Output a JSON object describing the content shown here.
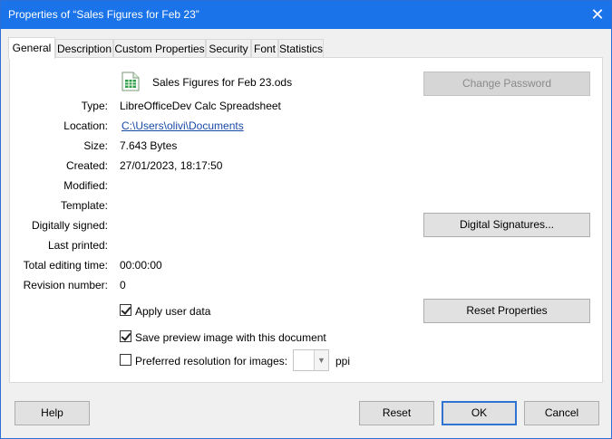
{
  "window": {
    "title": "Properties of “Sales Figures for Feb 23”",
    "close_glyph": "✕"
  },
  "tabs": [
    {
      "label": "General"
    },
    {
      "label": "Description"
    },
    {
      "label": "Custom Properties"
    },
    {
      "label": "Security"
    },
    {
      "label": "Font"
    },
    {
      "label": "Statistics"
    }
  ],
  "general": {
    "file_name": "Sales Figures for Feb 23.ods",
    "change_password_label": "Change Password",
    "labels": {
      "type": "Type:",
      "location": "Location:",
      "size": "Size:",
      "created": "Created:",
      "modified": "Modified:",
      "template": "Template:",
      "digitally_signed": "Digitally signed:",
      "last_printed": "Last printed:",
      "total_editing_time": "Total editing time:",
      "revision_number": "Revision number:"
    },
    "values": {
      "type": "LibreOfficeDev Calc Spreadsheet",
      "location": "C:\\Users\\olivi\\Documents",
      "size": "7.643 Bytes",
      "created": "27/01/2023, 18:17:50",
      "modified": "",
      "template": "",
      "digitally_signed": "",
      "last_printed": "",
      "total_editing_time": "00:00:00",
      "revision_number": "0"
    },
    "digital_signatures_label": "Digital Signatures...",
    "apply_user_data_label": "Apply user data",
    "apply_user_data_checked": true,
    "reset_properties_label": "Reset Properties",
    "save_preview_label": "Save preview image with this document",
    "save_preview_checked": true,
    "preferred_resolution_label": "Preferred resolution for images:",
    "preferred_resolution_checked": false,
    "preferred_resolution_value": "",
    "ppi_label": "ppi"
  },
  "footer": {
    "help_label": "Help",
    "reset_label": "Reset",
    "ok_label": "OK",
    "cancel_label": "Cancel"
  }
}
